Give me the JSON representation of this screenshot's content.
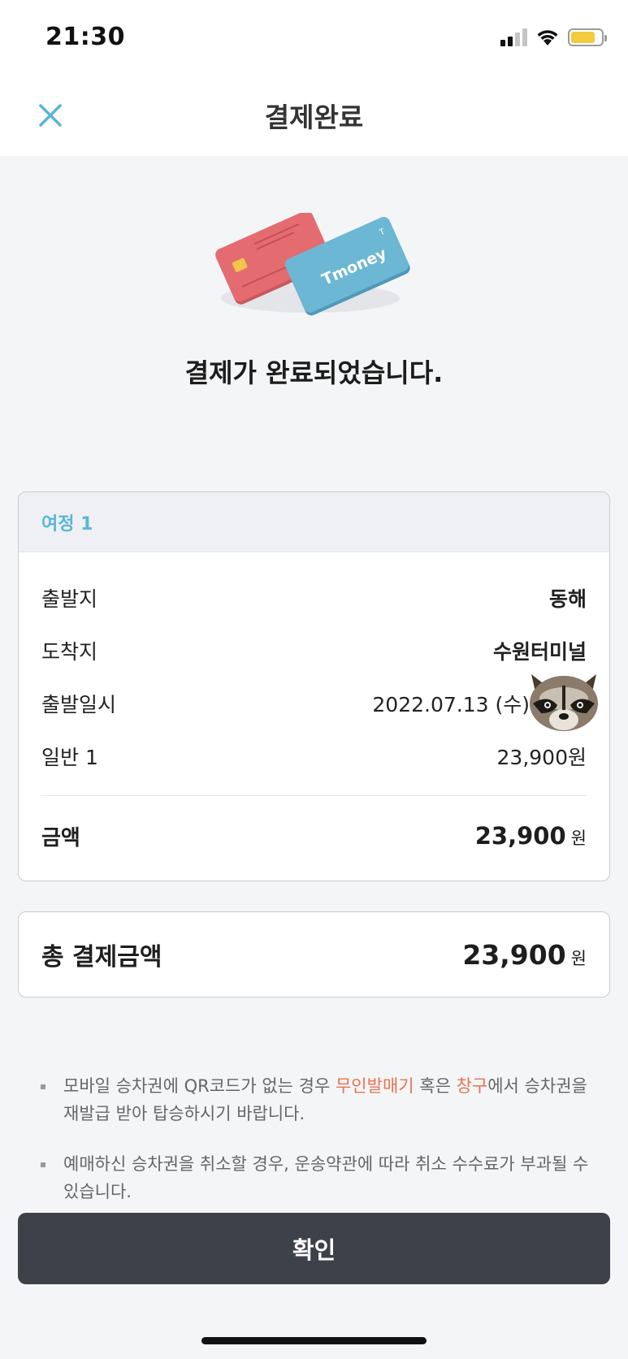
{
  "status_bar": {
    "time": "21:30",
    "signal_icon": "cellular-signal-icon",
    "wifi_icon": "wifi-icon",
    "battery_icon": "battery-icon",
    "battery_color": "#f4cb3f"
  },
  "nav": {
    "title": "결제완료",
    "close_icon": "close-icon",
    "accent_color": "#58b6d6"
  },
  "hero": {
    "message": "결제가 완료되었습니다.",
    "card_brand_text": "Tmoney",
    "card_badge": "T"
  },
  "journey": {
    "header": "여정 1",
    "rows": [
      {
        "label": "출발지",
        "value": "동해"
      },
      {
        "label": "도착지",
        "value": "수원터미널"
      },
      {
        "label": "출발일시",
        "value": "2022.07.13 (수)"
      },
      {
        "label": "일반 1",
        "value": "23,900원"
      }
    ],
    "amount": {
      "label": "금액",
      "value": "23,900",
      "unit": "원"
    }
  },
  "total": {
    "label": "총 결제금액",
    "value": "23,900",
    "unit": "원"
  },
  "notes": [
    {
      "before": "모바일 승차권에 QR코드가 없는 경우 ",
      "hl1": "무인발매기",
      "middle": " 혹은 ",
      "hl2": "창구",
      "after": "에서 승차권을 재발급 받아 탑승하시기 바랍니다."
    },
    {
      "text": "예매하신 승차권을 취소할 경우, 운송약관에 따라 취소 수수료가 부과될 수 있습니다."
    }
  ],
  "highlight_color": "#e8734f",
  "confirm_button": {
    "label": "확인",
    "color": "#3d4149"
  }
}
